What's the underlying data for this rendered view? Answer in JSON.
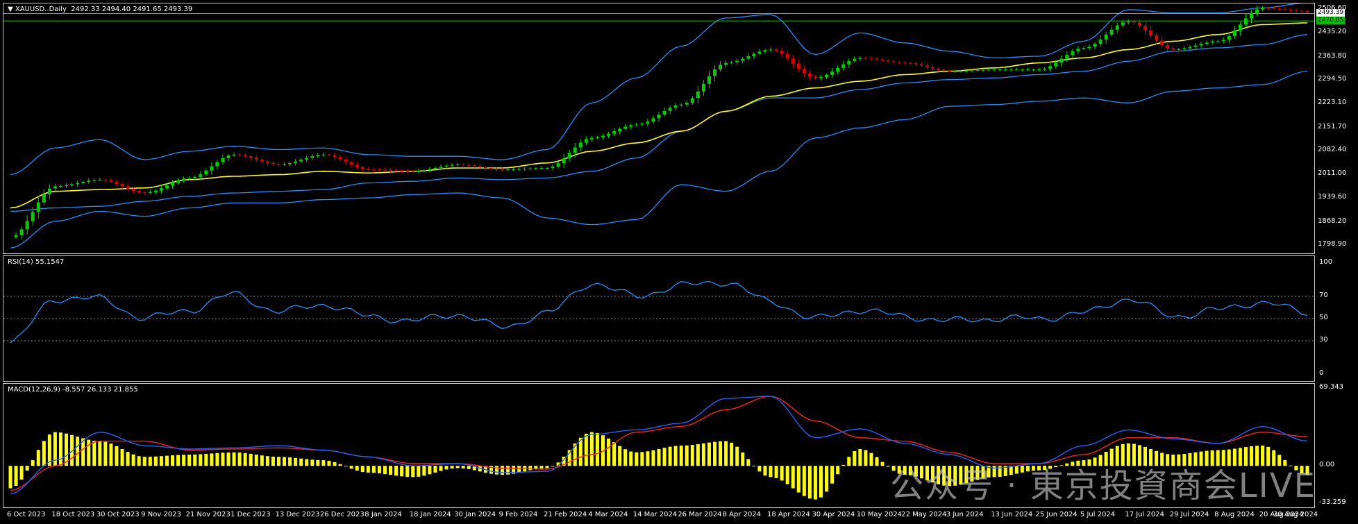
{
  "panels": {
    "main": {
      "title": "▼ XAUUSD..Daily  2492.33 2494.40 2491.65 2493.39",
      "price_ticks": [
        "2506.60",
        "2435.20",
        "2363.80",
        "2294.50",
        "2223.10",
        "2151.70",
        "2082.40",
        "2011.00",
        "1939.60",
        "1868.20",
        "1798.90"
      ],
      "price_min": 1798.9,
      "price_max": 2506.6,
      "current_price": "2493.39",
      "level_price": "2470.85",
      "colors": {
        "bull": "#00d000",
        "bear": "#e00000",
        "bands": "#1e90ff",
        "ma": "#ffff00",
        "level_line": "#00c000",
        "current_line": "#c0c0c0"
      }
    },
    "rsi": {
      "title": "RSI(14) 55.1547",
      "ticks": [
        "100",
        "70",
        "50",
        "30",
        "0"
      ],
      "line_color": "#1e90ff"
    },
    "macd": {
      "title": "MACD(12,26,9) -8.557 26.133 21.855",
      "ticks": [
        "69.343",
        "0.00",
        "-33.259"
      ],
      "colors": {
        "hist": "#ffff00",
        "macd": "#1e62ff",
        "signal": "#ff1e1e"
      }
    }
  },
  "dates": [
    "6 Oct 2023",
    "18 Oct 2023",
    "30 Oct 2023",
    "9 Nov 2023",
    "21 Nov 2023",
    "1 Dec 2023",
    "13 Dec 2023",
    "26 Dec 2023",
    "8 Jan 2024",
    "18 Jan 2024",
    "30 Jan 2024",
    "9 Feb 2024",
    "21 Feb 2024",
    "4 Mar 2024",
    "14 Mar 2024",
    "26 Mar 2024",
    "8 Apr 2024",
    "18 Apr 2024",
    "30 Apr 2024",
    "10 May 2024",
    "22 May 2024",
    "3 Jun 2024",
    "13 Jun 2024",
    "25 Jun 2024",
    "5 Jul 2024",
    "17 Jul 2024",
    "29 Jul 2024",
    "8 Aug 2024",
    "20 Aug 2024",
    "30 Aug 2024"
  ],
  "watermark": "公众号 · 東京投資商会LIVE",
  "chart_data": [
    {
      "type": "line",
      "title": "XAUUSD..Daily",
      "x": [
        "6 Oct 2023",
        "18 Oct 2023",
        "30 Oct 2023",
        "9 Nov 2023",
        "21 Nov 2023",
        "1 Dec 2023",
        "13 Dec 2023",
        "26 Dec 2023",
        "8 Jan 2024",
        "18 Jan 2024",
        "30 Jan 2024",
        "9 Feb 2024",
        "21 Feb 2024",
        "4 Mar 2024",
        "14 Mar 2024",
        "26 Mar 2024",
        "8 Apr 2024",
        "18 Apr 2024",
        "30 Apr 2024",
        "10 May 2024",
        "22 May 2024",
        "3 Jun 2024",
        "13 Jun 2024",
        "25 Jun 2024",
        "5 Jul 2024",
        "17 Jul 2024",
        "29 Jul 2024",
        "8 Aug 2024",
        "20 Aug 2024",
        "30 Aug 2024"
      ],
      "series": [
        {
          "values": [
            1822,
            1975,
            1995,
            1955,
            2000,
            2070,
            2040,
            2070,
            2025,
            2020,
            2040,
            2025,
            2030,
            2120,
            2160,
            2220,
            2345,
            2385,
            2300,
            2360,
            2345,
            2320,
            2325,
            2325,
            2390,
            2470,
            2385,
            2410,
            2510,
            2500
          ]
        },
        {
          "values": [
            1910,
            1960,
            1965,
            1970,
            1995,
            2005,
            2010,
            2020,
            2015,
            2020,
            2030,
            2030,
            2045,
            2080,
            2105,
            2140,
            2200,
            2245,
            2270,
            2290,
            2310,
            2320,
            2330,
            2345,
            2360,
            2385,
            2410,
            2430,
            2460,
            2465
          ]
        },
        {
          "values": [
            2010,
            2090,
            2115,
            2055,
            2080,
            2095,
            2085,
            2090,
            2070,
            2065,
            2065,
            2055,
            2085,
            2225,
            2300,
            2395,
            2480,
            2490,
            2370,
            2435,
            2405,
            2380,
            2360,
            2365,
            2410,
            2505,
            2495,
            2495,
            2510,
            2525
          ]
        },
        {
          "values": [
            1900,
            1910,
            1915,
            1930,
            1945,
            1955,
            1960,
            1965,
            1985,
            1990,
            2000,
            1995,
            2000,
            2020,
            2060,
            2140,
            2200,
            2240,
            2240,
            2265,
            2285,
            2295,
            2300,
            2310,
            2320,
            2350,
            2380,
            2390,
            2400,
            2430
          ]
        },
        {
          "values": [
            1790,
            1870,
            1900,
            1885,
            1910,
            1925,
            1925,
            1935,
            1940,
            1950,
            1955,
            1940,
            1880,
            1860,
            1875,
            1980,
            1960,
            2020,
            2120,
            2150,
            2175,
            2215,
            2220,
            2230,
            2240,
            2225,
            2260,
            2270,
            2280,
            2320
          ]
        }
      ],
      "ylim": [
        1798.9,
        2506.6
      ]
    },
    {
      "type": "line",
      "title": "RSI(14) 55.1547",
      "x": [
        "6 Oct 2023",
        "18 Oct 2023",
        "30 Oct 2023",
        "9 Nov 2023",
        "21 Nov 2023",
        "1 Dec 2023",
        "13 Dec 2023",
        "26 Dec 2023",
        "8 Jan 2024",
        "18 Jan 2024",
        "30 Jan 2024",
        "9 Feb 2024",
        "21 Feb 2024",
        "4 Mar 2024",
        "14 Mar 2024",
        "26 Mar 2024",
        "8 Apr 2024",
        "18 Apr 2024",
        "30 Apr 2024",
        "10 May 2024",
        "22 May 2024",
        "3 Jun 2024",
        "13 Jun 2024",
        "25 Jun 2024",
        "5 Jul 2024",
        "17 Jul 2024",
        "29 Jul 2024",
        "8 Aug 2024",
        "20 Aug 2024",
        "30 Aug 2024"
      ],
      "values": [
        28,
        68,
        68,
        50,
        58,
        72,
        56,
        63,
        52,
        48,
        54,
        42,
        55,
        82,
        70,
        80,
        83,
        65,
        50,
        58,
        52,
        48,
        50,
        50,
        55,
        68,
        52,
        58,
        65,
        55
      ],
      "ylim": [
        0,
        100
      ],
      "levels": [
        30,
        50,
        70
      ]
    },
    {
      "type": "bar",
      "title": "MACD(12,26,9) -8.557 26.133 21.855",
      "categories": [
        "6 Oct 2023",
        "18 Oct 2023",
        "30 Oct 2023",
        "9 Nov 2023",
        "21 Nov 2023",
        "1 Dec 2023",
        "13 Dec 2023",
        "26 Dec 2023",
        "8 Jan 2024",
        "18 Jan 2024",
        "30 Jan 2024",
        "9 Feb 2024",
        "21 Feb 2024",
        "4 Mar 2024",
        "14 Mar 2024",
        "26 Mar 2024",
        "8 Apr 2024",
        "18 Apr 2024",
        "30 Apr 2024",
        "10 May 2024",
        "22 May 2024",
        "3 Jun 2024",
        "13 Jun 2024",
        "25 Jun 2024",
        "5 Jul 2024",
        "17 Jul 2024",
        "29 Jul 2024",
        "8 Aug 2024",
        "20 Aug 2024",
        "30 Aug 2024"
      ],
      "series": [
        {
          "values": [
            -20,
            30,
            22,
            8,
            10,
            12,
            8,
            5,
            -6,
            -10,
            -2,
            -8,
            -2,
            30,
            12,
            18,
            22,
            -10,
            -30,
            15,
            -8,
            -18,
            -10,
            -4,
            5,
            20,
            10,
            14,
            18,
            -8
          ]
        },
        {
          "values": [
            -25,
            5,
            30,
            18,
            15,
            16,
            18,
            14,
            8,
            0,
            2,
            -6,
            -5,
            28,
            32,
            38,
            60,
            62,
            25,
            33,
            20,
            10,
            -2,
            2,
            18,
            32,
            24,
            20,
            35,
            22
          ]
        },
        {
          "values": [
            -22,
            0,
            22,
            22,
            14,
            15,
            16,
            14,
            8,
            2,
            2,
            -2,
            -3,
            10,
            30,
            35,
            50,
            62,
            40,
            25,
            22,
            12,
            2,
            2,
            10,
            25,
            25,
            20,
            30,
            26
          ]
        }
      ],
      "ylim": [
        -33.259,
        69.343
      ]
    }
  ]
}
